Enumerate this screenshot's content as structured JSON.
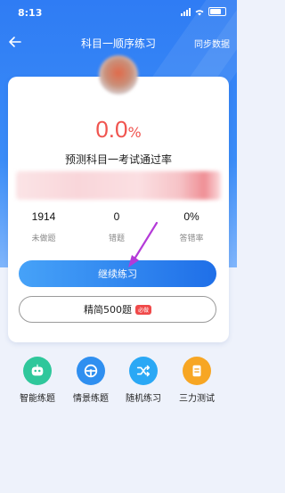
{
  "status": {
    "time": "8:13"
  },
  "nav": {
    "title": "科目一顺序练习",
    "right": "同步数据"
  },
  "pass": {
    "value": "0.0",
    "unit": "%",
    "label": "预测科目一考试通过率"
  },
  "stats": [
    {
      "value": "1914",
      "label": "未做题"
    },
    {
      "value": "0",
      "label": "错题"
    },
    {
      "value": "0%",
      "label": "答错率"
    }
  ],
  "buttons": {
    "continue": "继续练习",
    "streamlined": "精简500题",
    "tag": "必做"
  },
  "features": [
    {
      "label": "智能练题",
      "icon": "robot-icon",
      "color": "#2fc79b"
    },
    {
      "label": "情景练题",
      "icon": "steering-wheel-icon",
      "color": "#2f8ff0"
    },
    {
      "label": "随机练习",
      "icon": "shuffle-icon",
      "color": "#2aa8f5"
    },
    {
      "label": "三力测试",
      "icon": "document-icon",
      "color": "#f7a623"
    }
  ],
  "colors": {
    "primary": "#2f7cf4",
    "rate": "#f0544f"
  }
}
